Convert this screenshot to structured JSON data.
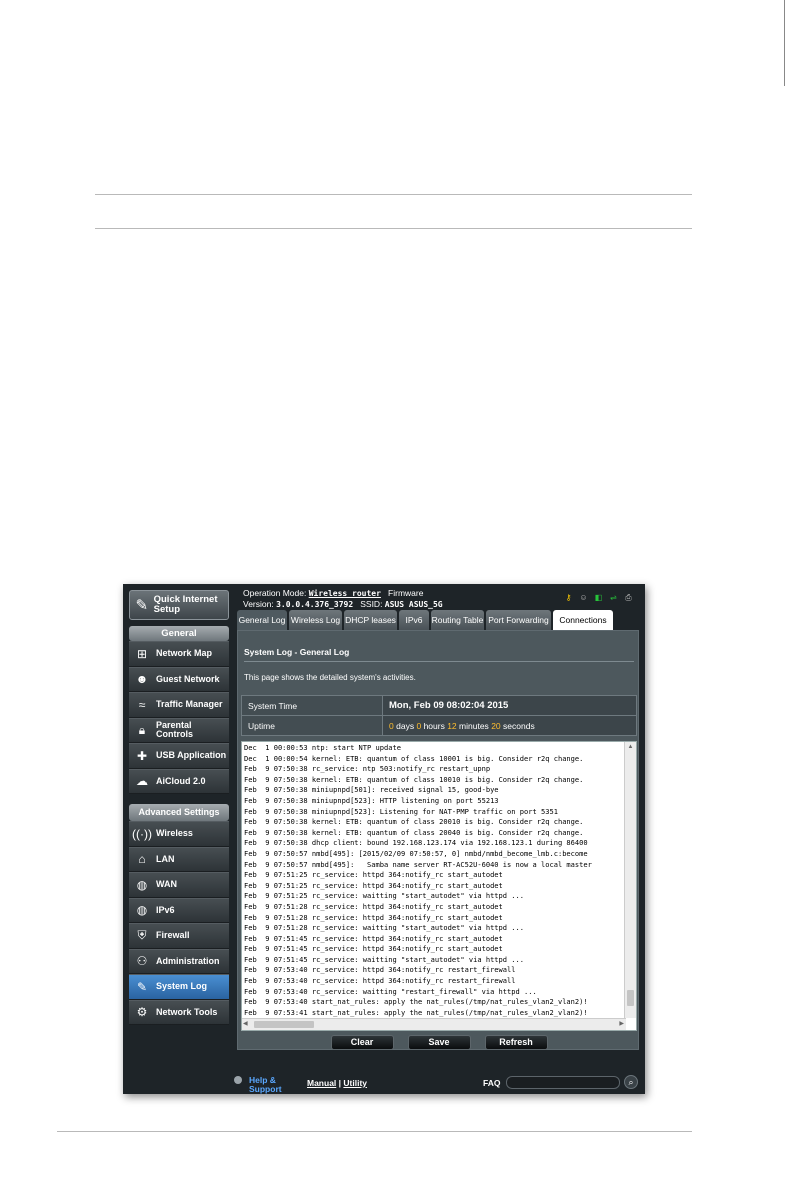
{
  "page": {
    "number": "",
    "accent_color": "#4a8fd2"
  },
  "router": {
    "top": {
      "op_mode_label": "Operation Mode: ",
      "op_mode_value": "Wireless router",
      "firmware_label": "Firmware",
      "version_label": "Version: ",
      "version_value": "3.0.0.4.376_3792",
      "ssid_label": "SSID: ",
      "ssid_value": "ASUS ASUS_5G"
    },
    "sidebar": {
      "quick_setup": "Quick Internet Setup",
      "general_header": "General",
      "general_items": [
        {
          "label": "Network Map",
          "icon": "network-map-icon"
        },
        {
          "label": "Guest Network",
          "icon": "guest-network-icon"
        },
        {
          "label": "Traffic Manager",
          "icon": "traffic-manager-icon"
        },
        {
          "label": "Parental Controls",
          "icon": "lock-icon"
        },
        {
          "label": "USB Application",
          "icon": "puzzle-icon"
        },
        {
          "label": "AiCloud 2.0",
          "icon": "cloud-icon"
        }
      ],
      "advanced_header": "Advanced Settings",
      "advanced_items": [
        {
          "label": "Wireless",
          "icon": "wifi-icon"
        },
        {
          "label": "LAN",
          "icon": "home-icon"
        },
        {
          "label": "WAN",
          "icon": "globe-icon"
        },
        {
          "label": "IPv6",
          "icon": "globe-icon"
        },
        {
          "label": "Firewall",
          "icon": "shield-icon"
        },
        {
          "label": "Administration",
          "icon": "admin-icon"
        },
        {
          "label": "System Log",
          "icon": "log-icon",
          "active": true
        },
        {
          "label": "Network Tools",
          "icon": "tools-icon"
        }
      ]
    },
    "tabs": [
      "General Log",
      "Wireless Log",
      "DHCP leases",
      "IPv6",
      "Routing Table",
      "Port Forwarding",
      "Connections"
    ],
    "content": {
      "title": "System Log - General Log",
      "description": "This page shows the detailed system's activities.",
      "system_time_label": "System Time",
      "system_time_value": "Mon, Feb 09  08:02:04  2015",
      "uptime_label": "Uptime",
      "uptime": {
        "days": "0",
        "days_label": "days",
        "hours": "0",
        "hours_label": "hours",
        "minutes": "12",
        "minutes_label": "minutes",
        "seconds": "20",
        "seconds_label": "seconds"
      }
    },
    "log_lines": [
      "Dec  1 00:00:53 ntp: start NTP update",
      "Dec  1 00:00:54 kernel: ETB: quantum of class 10001 is big. Consider r2q change.",
      "Feb  9 07:50:38 rc_service: ntp 503:notify_rc restart_upnp",
      "Feb  9 07:50:38 kernel: ETB: quantum of class 10010 is big. Consider r2q change.",
      "Feb  9 07:50:38 miniupnpd[501]: received signal 15, good-bye",
      "Feb  9 07:50:38 miniupnpd[523]: HTTP listening on port 55213",
      "Feb  9 07:50:38 miniupnpd[523]: Listening for NAT-PMP traffic on port 5351",
      "Feb  9 07:50:38 kernel: ETB: quantum of class 20010 is big. Consider r2q change.",
      "Feb  9 07:50:38 kernel: ETB: quantum of class 20040 is big. Consider r2q change.",
      "Feb  9 07:50:38 dhcp client: bound 192.168.123.174 via 192.168.123.1 during 86400",
      "Feb  9 07:50:57 nmbd[495]: [2015/02/09 07:50:57, 0] nmbd/nmbd_become_lmb.c:become",
      "Feb  9 07:50:57 nmbd[495]:   Samba name server RT-AC52U-6040 is now a local master",
      "Feb  9 07:51:25 rc_service: httpd 364:notify_rc start_autodet",
      "Feb  9 07:51:25 rc_service: httpd 364:notify_rc start_autodet",
      "Feb  9 07:51:25 rc_service: waitting \"start_autodet\" via httpd ...",
      "Feb  9 07:51:28 rc_service: httpd 364:notify_rc start_autodet",
      "Feb  9 07:51:28 rc_service: httpd 364:notify_rc start_autodet",
      "Feb  9 07:51:28 rc_service: waitting \"start_autodet\" via httpd ...",
      "Feb  9 07:51:45 rc_service: httpd 364:notify_rc start_autodet",
      "Feb  9 07:51:45 rc_service: httpd 364:notify_rc start_autodet",
      "Feb  9 07:51:45 rc_service: waitting \"start_autodet\" via httpd ...",
      "Feb  9 07:53:40 rc_service: httpd 364:notify_rc restart_firewall",
      "Feb  9 07:53:40 rc_service: httpd 364:notify_rc restart_firewall",
      "Feb  9 07:53:40 rc_service: waitting \"restart_firewall\" via httpd ...",
      "Feb  9 07:53:40 start_nat_rules: apply the nat_rules(/tmp/nat_rules_vlan2_vlan2)!",
      "Feb  9 07:53:41 start_nat_rules: apply the nat_rules(/tmp/nat_rules_vlan2_vlan2)!"
    ],
    "buttons": {
      "clear": "Clear",
      "save": "Save",
      "refresh": "Refresh"
    },
    "footer": {
      "help": "Help & Support",
      "manual": "Manual",
      "separator": " | ",
      "utility": "Utility",
      "faq": "FAQ",
      "search_value": ""
    }
  }
}
